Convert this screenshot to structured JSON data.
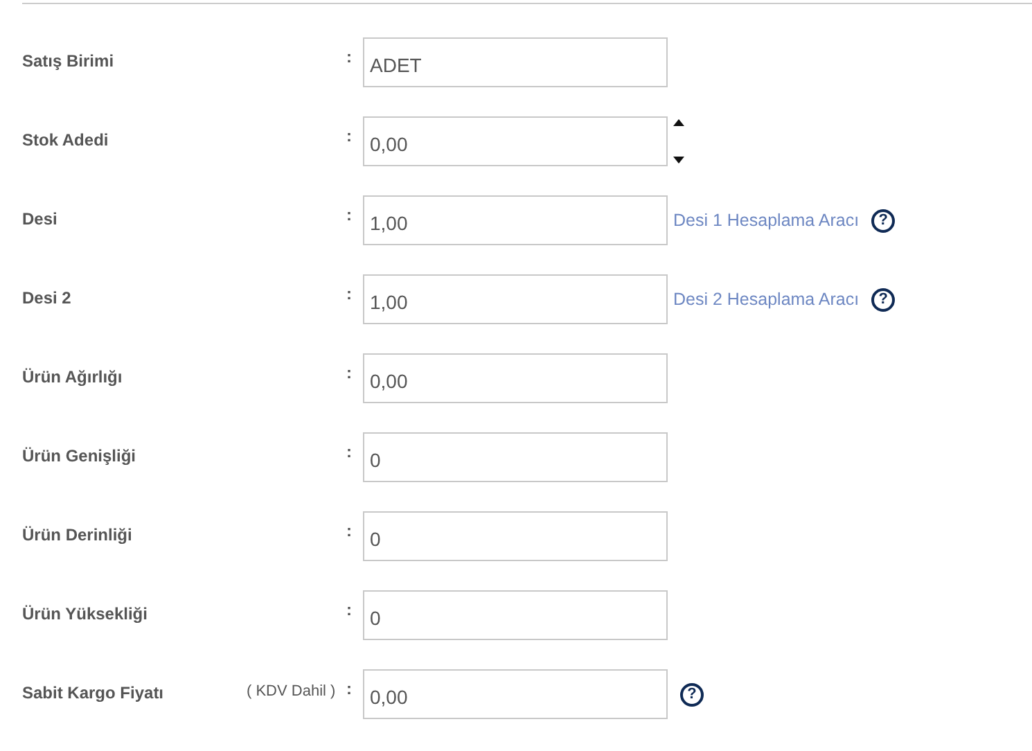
{
  "fields": [
    {
      "kind": "plain",
      "label": "Satış Birimi",
      "colon": ":",
      "value": "ADET"
    },
    {
      "kind": "spinner",
      "label": "Stok Adedi",
      "colon": ":",
      "value": "0,00"
    },
    {
      "kind": "plain",
      "label": "Desi",
      "colon": ":",
      "value": "1,00",
      "link": "Desi 1 Hesaplama Aracı",
      "help": "?"
    },
    {
      "kind": "plain",
      "label": "Desi 2",
      "colon": ":",
      "value": "1,00",
      "link": "Desi 2 Hesaplama Aracı",
      "help": "?"
    },
    {
      "kind": "plain",
      "label": "Ürün Ağırlığı",
      "colon": ":",
      "value": "0,00"
    },
    {
      "kind": "plain",
      "label": "Ürün Genişliği",
      "colon": ":",
      "value": "0"
    },
    {
      "kind": "plain",
      "label": "Ürün Derinliği",
      "colon": ":",
      "value": "0"
    },
    {
      "kind": "plain",
      "label": "Ürün Yüksekliği",
      "colon": ":",
      "value": "0"
    },
    {
      "kind": "plain",
      "label": "Sabit Kargo Fiyatı",
      "note": "( KDV Dahil )",
      "colon": ":",
      "value": "0,00",
      "help": "?"
    }
  ]
}
